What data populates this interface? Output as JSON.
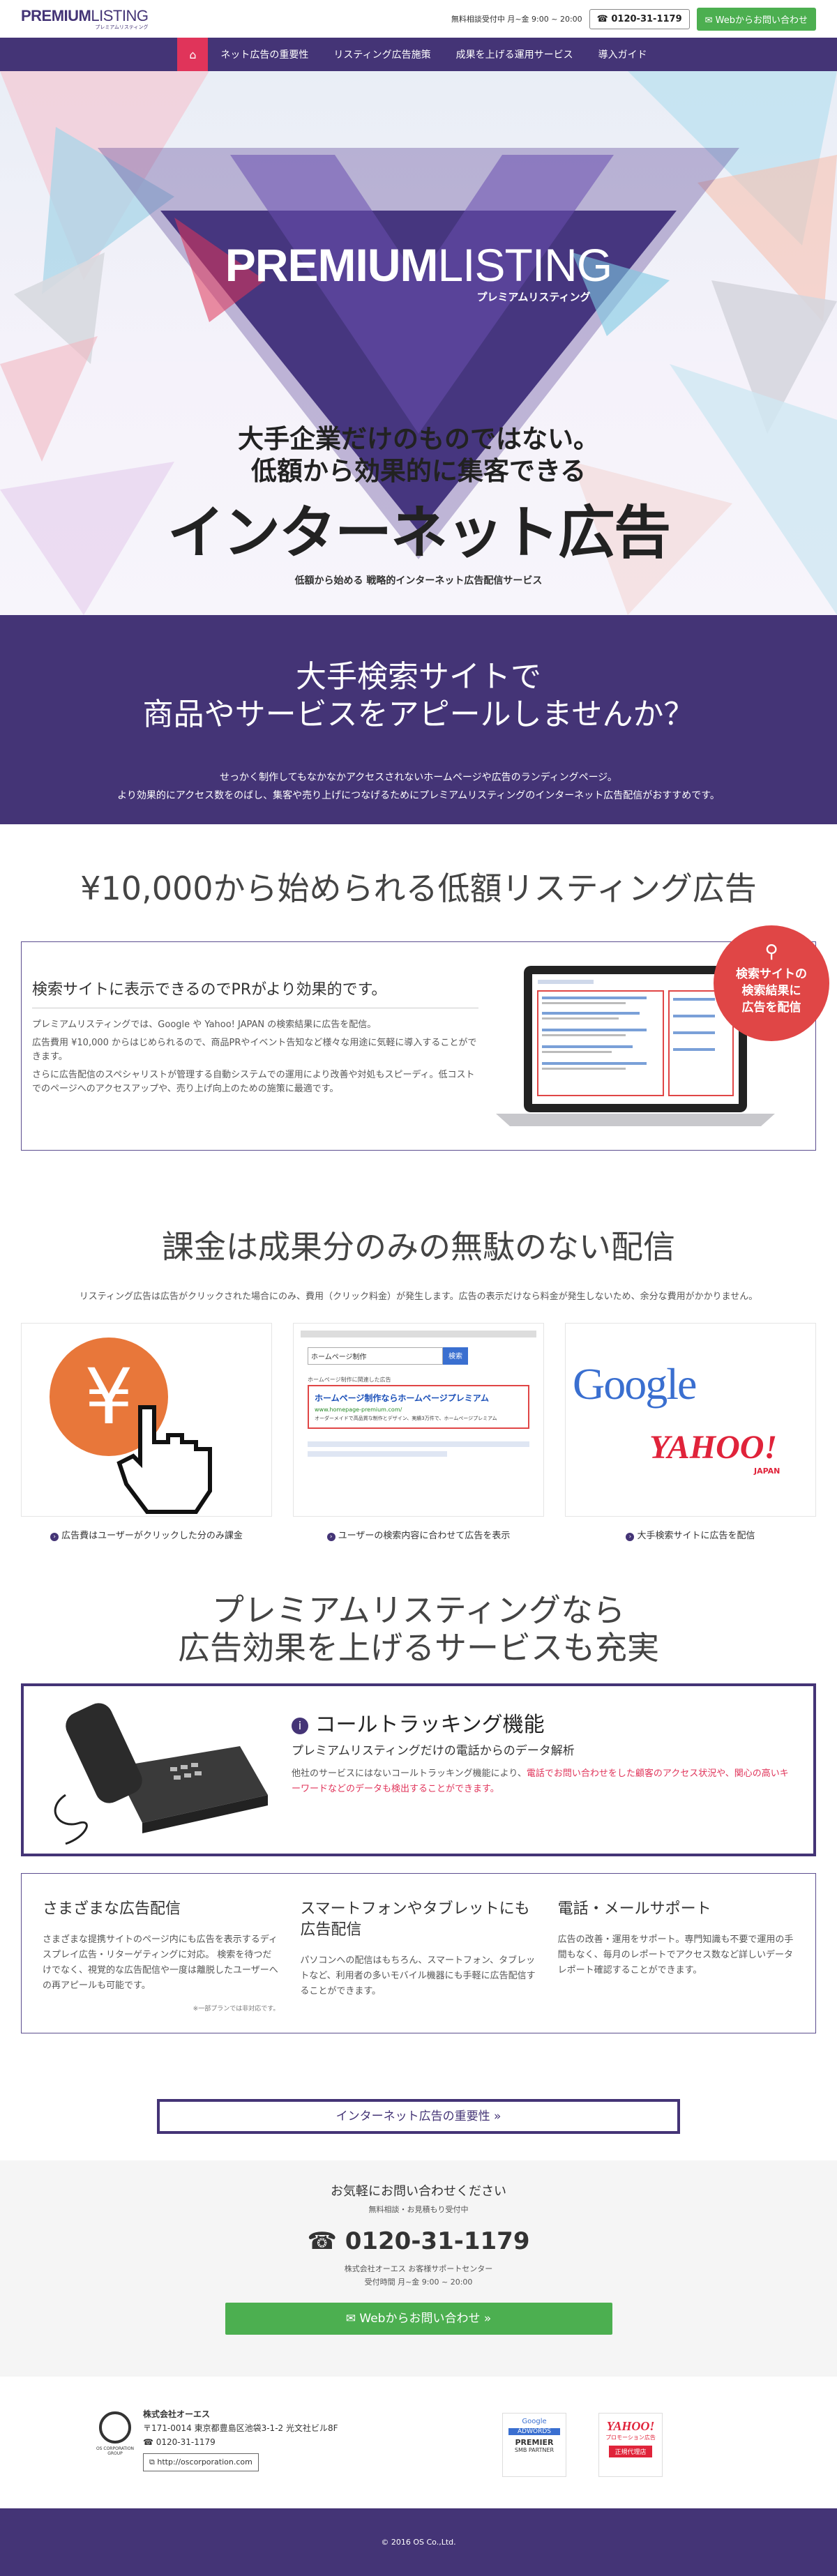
{
  "header": {
    "logo_main_bold": "PREMIUM",
    "logo_main_light": "LISTING",
    "logo_sub": "プレミアムリスティング",
    "hours": "無料相談受付中 月~金 9:00 ~ 20:00",
    "tel": "0120-31-1179",
    "web_contact": "Webからお問い合わせ"
  },
  "nav": {
    "items": [
      "ネット広告の重要性",
      "リスティング広告施策",
      "成果を上げる運用サービス",
      "導入ガイド"
    ]
  },
  "hero": {
    "brand_bold": "PREMIUM",
    "brand_light": "LISTING",
    "brand_sub": "プレミアムリスティング",
    "headline1": "大手企業だけのものではない。",
    "headline2": "低額から効果的に集客できる",
    "headline_big": "インターネット広告",
    "tagline": "低額から始める 戦略的インターネット広告配信サービス"
  },
  "intro": {
    "title_line1": "大手検索サイトで",
    "title_line2": "商品やサービスをアピールしませんか？",
    "body_line1": "せっかく制作してもなかなかアクセスされないホームページや広告のランディングページ。",
    "body_line2": "より効果的にアクセス数をのばし、集客や売り上げにつなげるためにプレミアムリスティングのインターネット広告配信がおすすめです。"
  },
  "pricing": {
    "title": "¥10,000から始められる低額リスティング広告",
    "box_title": "検索サイトに表示できるのでPRがより効果的です。",
    "para1": "プレミアムリスティングでは、Google や Yahoo! JAPAN の検索結果に広告を配信。",
    "para2": "広告費用 ¥10,000 からはじめられるので、商品PRやイベント告知など様々な用途に気軽に導入することができます。",
    "para3": "さらに広告配信のスペシャリストが管理する自動システムでの運用により改善や対処もスピーディ。低コストでのページへのアクセスアップや、売り上げ向上のための施策に最適です。",
    "badge_line1": "検索サイトの",
    "badge_line2": "検索結果に",
    "badge_line3": "広告を配信"
  },
  "billing": {
    "title": "課金は成果分のみの無駄のない配信",
    "subtitle": "リスティング広告は広告がクリックされた場合にのみ、費用（クリック料金）が発生します。広告の表示だけなら料金が発生しないため、余分な費用がかかりません。",
    "card1_symbol": "¥",
    "card1_caption": "広告費はユーザーがクリックした分のみ課金",
    "card2_search": "ホームページ制作",
    "card2_search_btn": "検索",
    "card2_ad_label": "ホームページ制作に関連した広告",
    "card2_ad_title": "ホームページ制作ならホームページプレミアム",
    "card2_ad_url": "www.homepage-premium.com/",
    "card2_ad_desc": "オーダーメイドで高品質な制作とデザイン、実績3万件で、ホームページプレミアム",
    "card2_caption": "ユーザーの検索内容に合わせて広告を表示",
    "card3_google": "Google",
    "card3_yahoo": "YAHOO!",
    "card3_japan": "JAPAN",
    "card3_caption": "大手検索サイトに広告を配信"
  },
  "services": {
    "title_line1": "プレミアムリスティングなら",
    "title_line2": "広告効果を上げるサービスも充実",
    "ct_title": "コールトラッキング機能",
    "ct_subtitle": "プレミアムリスティングだけの電話からのデータ解析",
    "ct_body_plain": "他社のサービスにはないコールトラッキング機能により、",
    "ct_body_highlight": "電話でお問い合わせをした顧客のアクセス状況や、関心の高いキーワードなどのデータも検出することができます。",
    "features": [
      {
        "title": "さまざまな広告配信",
        "body": "さまざまな提携サイトのページ内にも広告を表示するディスプレイ広告・リターゲティングに対応。 検索を待つだけでなく、視覚的な広告配信や一度は離脱したユーザーへの再アピールも可能です。",
        "note": "※一部プランでは非対応です。"
      },
      {
        "title": "スマートフォンやタブレットにも広告配信",
        "body": "パソコンへの配信はもちろん、スマートフォン、タブレットなど、利用者の多いモバイル機器にも手軽に広告配信することができます。",
        "note": ""
      },
      {
        "title": "電話・メールサポート",
        "body": "広告の改善・運用をサポート。専門知識も不要で運用の手間もなく、毎月のレポートでアクセス数など詳しいデータレポート確認することができます。",
        "note": ""
      }
    ],
    "more_button": "インターネット広告の重要性 »"
  },
  "contact": {
    "line1": "お気軽にお問い合わせください",
    "line2": "無料相談・お見積もり受付中",
    "tel": "0120-31-1179",
    "company_center": "株式会社オーエス お客様サポートセンター",
    "hours": "受付時間 月~金 9:00 ~ 20:00",
    "web_button": "Webからお問い合わせ »"
  },
  "footer": {
    "group_logo": "OS CORPORATION GROUP",
    "company": "株式会社オーエス",
    "address": "〒171-0014 東京都豊島区池袋3-1-2 光文社ビル8F",
    "tel": "0120-31-1179",
    "url": "http://oscorporation.com",
    "google_badge_1": "Google",
    "google_badge_2": "ADWORDS",
    "google_badge_3": "PREMIER",
    "google_badge_4": "SMB PARTNER",
    "yahoo_badge_1": "YAHOO!",
    "yahoo_badge_2": "プロモーション広告",
    "yahoo_badge_3": "正規代理店",
    "copyright": "© 2016 OS Co.,Ltd."
  },
  "colors": {
    "brand_purple": "#443476",
    "accent_pink": "#e0345a",
    "green": "#4caf50",
    "red": "#e04646"
  }
}
